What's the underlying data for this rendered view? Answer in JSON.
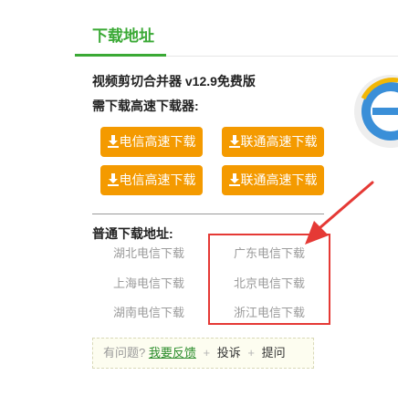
{
  "tab": {
    "title": "下载地址"
  },
  "software": {
    "name": "视频剪切合并器 v12.9免费版"
  },
  "high_speed": {
    "label": "需下载高速下载器:",
    "buttons": [
      {
        "label": "电信高速下载",
        "icon": "download-icon"
      },
      {
        "label": "联通高速下载",
        "icon": "download-icon"
      },
      {
        "label": "电信高速下载",
        "icon": "download-icon"
      },
      {
        "label": "联通高速下载",
        "icon": "download-icon"
      }
    ],
    "button_color": "#f49a00"
  },
  "normal": {
    "label": "普通下载地址:",
    "links": [
      {
        "label": "湖北电信下载"
      },
      {
        "label": "广东电信下载"
      },
      {
        "label": "上海电信下载"
      },
      {
        "label": "北京电信下载"
      },
      {
        "label": "湖南电信下载"
      },
      {
        "label": "浙江电信下载"
      }
    ]
  },
  "feedback": {
    "question": "有问题?",
    "link": "我要反馈",
    "plus": "+",
    "complaint": "投诉",
    "ask": "提问"
  },
  "colors": {
    "accent": "#3aa935",
    "highlight": "#e53935"
  }
}
